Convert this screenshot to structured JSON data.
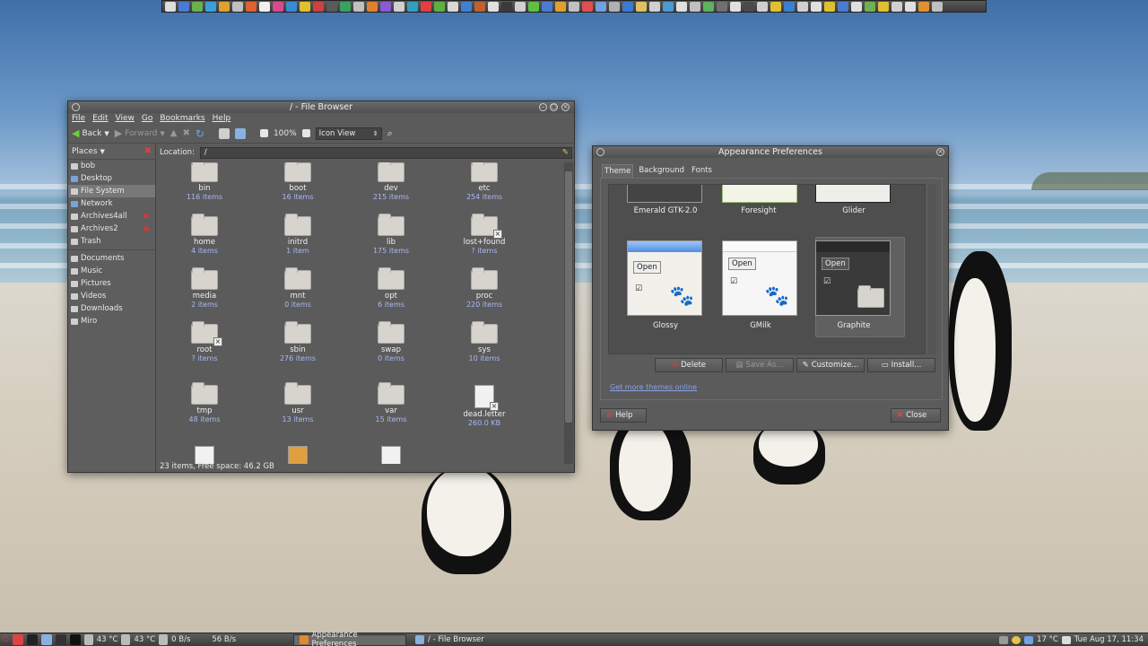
{
  "file_browser": {
    "title": "/ - File Browser",
    "menu": [
      "File",
      "Edit",
      "View",
      "Go",
      "Bookmarks",
      "Help"
    ],
    "toolbar": {
      "back": "Back",
      "forward": "Forward",
      "zoom": "100%",
      "view_mode": "Icon View"
    },
    "places_label": "Places",
    "places": [
      "bob",
      "Desktop",
      "File System",
      "Network",
      "Archives4all",
      "Archives2",
      "Trash"
    ],
    "bookmarks": [
      "Documents",
      "Music",
      "Pictures",
      "Videos",
      "Downloads",
      "Miro"
    ],
    "location_label": "Location:",
    "location_value": "/",
    "items": [
      {
        "name": "bin",
        "info": "116 items",
        "type": "folder"
      },
      {
        "name": "boot",
        "info": "16 items",
        "type": "folder"
      },
      {
        "name": "dev",
        "info": "215 items",
        "type": "folder"
      },
      {
        "name": "etc",
        "info": "254 items",
        "type": "folder"
      },
      {
        "name": "home",
        "info": "4 items",
        "type": "folder"
      },
      {
        "name": "initrd",
        "info": "1 item",
        "type": "folder"
      },
      {
        "name": "lib",
        "info": "175 items",
        "type": "folder"
      },
      {
        "name": "lost+found",
        "info": "? items",
        "type": "locked"
      },
      {
        "name": "media",
        "info": "2 items",
        "type": "folder"
      },
      {
        "name": "mnt",
        "info": "0 items",
        "type": "folder"
      },
      {
        "name": "opt",
        "info": "6 items",
        "type": "folder"
      },
      {
        "name": "proc",
        "info": "220 items",
        "type": "folder"
      },
      {
        "name": "root",
        "info": "? items",
        "type": "locked"
      },
      {
        "name": "sbin",
        "info": "276 items",
        "type": "folder"
      },
      {
        "name": "swap",
        "info": "0 items",
        "type": "folder"
      },
      {
        "name": "sys",
        "info": "10 items",
        "type": "folder"
      },
      {
        "name": "tmp",
        "info": "48 items",
        "type": "folder"
      },
      {
        "name": "usr",
        "info": "13 items",
        "type": "folder"
      },
      {
        "name": "var",
        "info": "15 items",
        "type": "folder"
      },
      {
        "name": "dead.letter",
        "info": "260.0 KB",
        "type": "doc-locked"
      }
    ],
    "status": "23 items, Free space: 46.2 GB"
  },
  "appearance": {
    "title": "Appearance Preferences",
    "tabs": [
      "Theme",
      "Background",
      "Fonts"
    ],
    "themes_top": [
      "Emerald GTK-2.0",
      "Foresight",
      "Glider"
    ],
    "themes": [
      "Glossy",
      "GMilk",
      "Graphite"
    ],
    "open_label": "Open",
    "buttons": {
      "delete": "Delete",
      "save_as": "Save As...",
      "customize": "Customize...",
      "install": "Install..."
    },
    "link": "Get more themes online",
    "help": "Help",
    "close": "Close"
  },
  "taskbar": {
    "temp1": "43 °C",
    "temp2": "43 °C",
    "net_down": "0 B/s",
    "net_up": "56 B/s",
    "tasks": [
      "Appearance Preferences",
      "/ - File Browser"
    ],
    "weather": "17 °C",
    "clock": "Tue Aug 17, 11:34"
  },
  "colors": {
    "window_bg": "#5b5b5b",
    "info_text": "#a9b7f5",
    "link": "#8aa2e8"
  }
}
